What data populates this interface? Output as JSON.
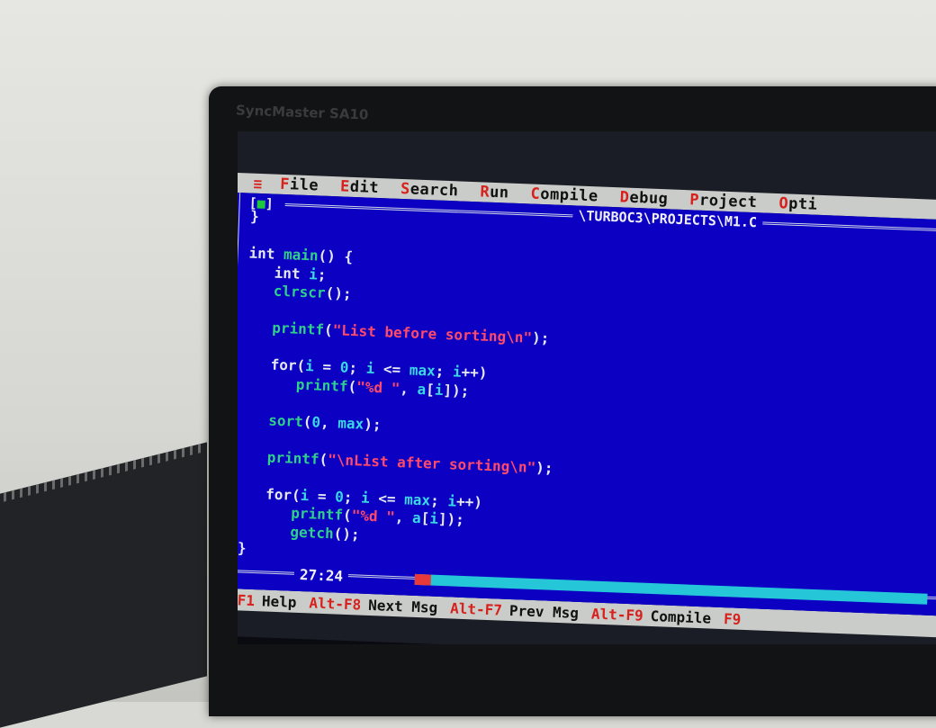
{
  "monitor": {
    "brand": "SyncMaster SA10"
  },
  "menubar": {
    "system": "≡",
    "items": [
      {
        "hot": "F",
        "rest": "ile"
      },
      {
        "hot": "E",
        "rest": "dit"
      },
      {
        "hot": "S",
        "rest": "earch"
      },
      {
        "hot": "R",
        "rest": "un"
      },
      {
        "hot": "C",
        "rest": "ompile"
      },
      {
        "hot": "D",
        "rest": "ebug"
      },
      {
        "hot": "P",
        "rest": "roject"
      },
      {
        "hot": "O",
        "rest": "pti"
      }
    ]
  },
  "editor": {
    "close_box_left": "[",
    "close_box_inner": "■",
    "close_box_right": "]",
    "title": "\\TURBOC3\\PROJECTS\\M1.C",
    "position": "27:24"
  },
  "code": {
    "lines": [
      [
        {
          "t": "}",
          "c": "pn"
        }
      ],
      [],
      [
        {
          "t": "int ",
          "c": "kw"
        },
        {
          "t": "main",
          "c": "fn"
        },
        {
          "t": "() {",
          "c": "pn"
        }
      ],
      [
        {
          "t": "   int ",
          "c": "kw"
        },
        {
          "t": "i",
          "c": "id"
        },
        {
          "t": ";",
          "c": "pn"
        }
      ],
      [
        {
          "t": "   clrscr",
          "c": "fn"
        },
        {
          "t": "();",
          "c": "pn"
        }
      ],
      [],
      [
        {
          "t": "   printf",
          "c": "fn"
        },
        {
          "t": "(",
          "c": "pn"
        },
        {
          "t": "\"List before sorting\\n\"",
          "c": "str"
        },
        {
          "t": ");",
          "c": "pn"
        }
      ],
      [],
      [
        {
          "t": "   for",
          "c": "kw"
        },
        {
          "t": "(",
          "c": "pn"
        },
        {
          "t": "i",
          "c": "id"
        },
        {
          "t": " = ",
          "c": "pn"
        },
        {
          "t": "0",
          "c": "num"
        },
        {
          "t": "; ",
          "c": "pn"
        },
        {
          "t": "i",
          "c": "id"
        },
        {
          "t": " <= ",
          "c": "pn"
        },
        {
          "t": "max",
          "c": "id"
        },
        {
          "t": "; ",
          "c": "pn"
        },
        {
          "t": "i",
          "c": "id"
        },
        {
          "t": "++)",
          "c": "pn"
        }
      ],
      [
        {
          "t": "      printf",
          "c": "fn"
        },
        {
          "t": "(",
          "c": "pn"
        },
        {
          "t": "\"%d \"",
          "c": "str"
        },
        {
          "t": ", ",
          "c": "pn"
        },
        {
          "t": "a",
          "c": "id"
        },
        {
          "t": "[",
          "c": "pn"
        },
        {
          "t": "i",
          "c": "id"
        },
        {
          "t": "]);",
          "c": "pn"
        }
      ],
      [],
      [
        {
          "t": "   sort",
          "c": "fn"
        },
        {
          "t": "(",
          "c": "pn"
        },
        {
          "t": "0",
          "c": "num"
        },
        {
          "t": ", ",
          "c": "pn"
        },
        {
          "t": "max",
          "c": "id"
        },
        {
          "t": ");",
          "c": "pn"
        }
      ],
      [],
      [
        {
          "t": "   printf",
          "c": "fn"
        },
        {
          "t": "(",
          "c": "pn"
        },
        {
          "t": "\"\\nList after sorting\\n\"",
          "c": "str"
        },
        {
          "t": ");",
          "c": "pn"
        }
      ],
      [],
      [
        {
          "t": "   for",
          "c": "kw"
        },
        {
          "t": "(",
          "c": "pn"
        },
        {
          "t": "i",
          "c": "id"
        },
        {
          "t": " = ",
          "c": "pn"
        },
        {
          "t": "0",
          "c": "num"
        },
        {
          "t": "; ",
          "c": "pn"
        },
        {
          "t": "i",
          "c": "id"
        },
        {
          "t": " <= ",
          "c": "pn"
        },
        {
          "t": "max",
          "c": "id"
        },
        {
          "t": "; ",
          "c": "pn"
        },
        {
          "t": "i",
          "c": "id"
        },
        {
          "t": "++)",
          "c": "pn"
        }
      ],
      [
        {
          "t": "      printf",
          "c": "fn"
        },
        {
          "t": "(",
          "c": "pn"
        },
        {
          "t": "\"%d \"",
          "c": "str"
        },
        {
          "t": ", ",
          "c": "pn"
        },
        {
          "t": "a",
          "c": "id"
        },
        {
          "t": "[",
          "c": "pn"
        },
        {
          "t": "i",
          "c": "id"
        },
        {
          "t": "]);",
          "c": "pn"
        }
      ],
      [
        {
          "t": "      getch",
          "c": "fn"
        },
        {
          "t": "();",
          "c": "pn"
        }
      ],
      [
        {
          "t": "}",
          "c": "pn"
        }
      ]
    ]
  },
  "helpbar": {
    "items": [
      {
        "key": "F1",
        "label": "Help"
      },
      {
        "key": "Alt-F8",
        "label": "Next Msg"
      },
      {
        "key": "Alt-F7",
        "label": "Prev Msg"
      },
      {
        "key": "Alt-F9",
        "label": "Compile"
      },
      {
        "key": "F9",
        "label": ""
      }
    ]
  },
  "colors": {
    "editor_background": "#0c00c2",
    "menubar_background": "#c9ccc9",
    "hotkey": "#d8201c",
    "string": "#ff4a6a",
    "function": "#2fd08a",
    "identifier": "#3ad8e6"
  }
}
